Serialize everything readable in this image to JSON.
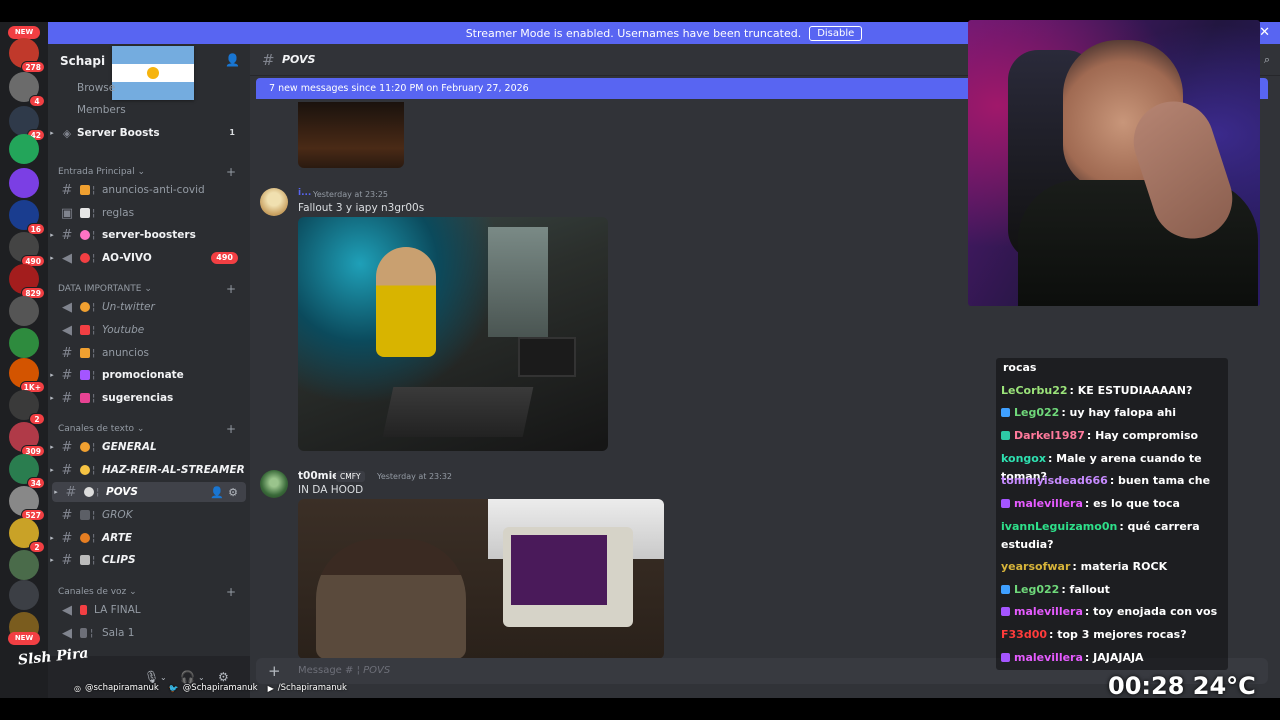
{
  "banner": {
    "text": "Streamer Mode is enabled. Usernames have been truncated.",
    "disable_label": "Disable",
    "close_label": "✕"
  },
  "rail": {
    "new_top": "NEW",
    "new_bottom": "NEW",
    "badges": [
      "278",
      "4",
      "42",
      "16",
      "490",
      "829",
      "1K+",
      "2",
      "309",
      "34",
      "527",
      "2"
    ]
  },
  "server": {
    "name": "Schapi",
    "browse_label": "Browse",
    "members_label": "Members",
    "boosts_label": "Server Boosts",
    "boosts_count": "1"
  },
  "categories": {
    "entrada": "Entrada Principal",
    "data": "DATA IMPORTANTE",
    "texto": "Canales de texto",
    "voz": "Canales de voz"
  },
  "channels": {
    "anuncios_anti_covid": "anuncios-anti-covid",
    "reglas": "reglas",
    "server_boosters": "server-boosters",
    "ao_vivo": "AO-VIVO",
    "ao_vivo_count": "490",
    "un_twitter": "Un-twitter",
    "youtube": "Youtube",
    "anuncios": "anuncios",
    "promocionate": "promocionate",
    "sugerencias": "sugerencias",
    "general": "GENERAL",
    "haz_reir": "HAZ-REIR-AL-STREAMER",
    "povs": "POVS",
    "grok": "GROK",
    "arte": "ARTE",
    "clips": "CLIPS",
    "la_final": "LA FINAL",
    "sala1": "Sala 1"
  },
  "main": {
    "channel_title": "POVS",
    "new_messages": "7 new messages since 11:20 PM on February 27, 2026",
    "composer_prefix": "Message #",
    "composer_channel": "POVS"
  },
  "messages": [
    {
      "author": "i...",
      "timestamp": "Yesterday at 23:25",
      "text": "Fallout 3 y iapy n3gr00s"
    },
    {
      "author": "t00mie",
      "tag": "CMFY",
      "timestamp": "Yesterday at 23:32",
      "text": "IN DA HOOD"
    }
  ],
  "stream_chat": [
    {
      "user": "",
      "text": "rocas",
      "color": "#ffffff",
      "badge": ""
    },
    {
      "user": "LeCorbu22",
      "text": ": KE ESTUDIAAAAN?",
      "color": "#9be37a",
      "badge": ""
    },
    {
      "user": "Leg022",
      "text": ": uy hay falopa ahi",
      "color": "#6fd87a",
      "badge": "#3fa0ff"
    },
    {
      "user": "Darkel1987",
      "text": ": Hay compromiso",
      "color": "#ff7a9c",
      "badge": "#2ec9a6"
    },
    {
      "user": "kongox",
      "text": ": Male y arena cuando te toman?",
      "color": "#2ee0b0",
      "badge": ""
    },
    {
      "user": "tommyisdead666",
      "text": ": buen tama che",
      "color": "#c78bff",
      "badge": ""
    },
    {
      "user": "malevillera",
      "text": ": es lo que toca",
      "color": "#e55bff",
      "badge": "#a455ff"
    },
    {
      "user": "ivannLeguizamo0n",
      "text": ": qué carrera estudia?",
      "color": "#2ee08a",
      "badge": ""
    },
    {
      "user": "yearsofwar",
      "text": ": materia ROCK",
      "color": "#d7b43a",
      "badge": ""
    },
    {
      "user": "Leg022",
      "text": ": fallout",
      "color": "#6fd87a",
      "badge": "#3fa0ff"
    },
    {
      "user": "malevillera",
      "text": ": toy enojada con vos",
      "color": "#e55bff",
      "badge": "#a455ff"
    },
    {
      "user": "F33d00",
      "text": ": top 3 mejores rocas?",
      "color": "#ff3b3b",
      "badge": ""
    },
    {
      "user": "malevillera",
      "text": ": JAJAJAJA",
      "color": "#e55bff",
      "badge": "#a455ff"
    }
  ],
  "overlay": {
    "instagram": "@schapiramanuk",
    "twitter": "@Schapiramanuk",
    "youtube": "/Schapiramanuk",
    "timer": "00:28",
    "temperature": "24°C",
    "logo": "Slsh Pira"
  },
  "colors": {
    "blurple": "#5865f2",
    "mention_red": "#f23f43",
    "sidebar_bg": "#2b2d31",
    "chat_bg": "#313338"
  }
}
